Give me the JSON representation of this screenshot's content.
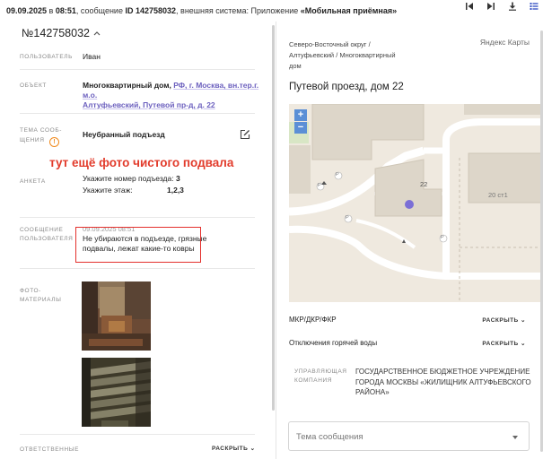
{
  "topbar": {
    "date": "09.09.2025",
    "in_label": " в ",
    "time": "08:51",
    "msg_label": ", сообщение ",
    "id_label": "ID 142758032",
    "system_label": ", внешняя система: Приложение ",
    "system_value": "«Мобильная приёмная»",
    "tools": [
      "first-page-icon",
      "last-page-icon",
      "download-icon",
      "list-icon"
    ]
  },
  "record": {
    "number": "№142758032",
    "user_label": "ПОЛЬЗОВАТЕЛЬ",
    "user_value": "Иван",
    "object_label": "ОБЪЕКТ",
    "object_type": "Многоквартирный дом, ",
    "object_link1": "РФ, г. Москва, вн.тер.г. м.о.",
    "object_link2": "Алтуфьевский, Путевой пр-д, д. 22",
    "topic_label_1": "ТЕМА СООБ-",
    "topic_label_2": "ЩЕНИЯ",
    "topic_value": "Неубранный подъезд",
    "survey_label": "АНКЕТА",
    "survey_q1": "Укажите номер подъезда:",
    "survey_a1": "3",
    "survey_q2": "Укажите этаж:",
    "survey_a2": "1,2,3",
    "message_label_1": "СООБЩЕНИЕ",
    "message_label_2": "ПОЛЬЗОВАТЕЛЯ",
    "message_date": "09.09.2025 08:51",
    "message_text": "Не убираются в подъезде, грязные подвалы, лежат какие-то ковры",
    "photos_label_1": "ФОТО-",
    "photos_label_2": "МАТЕРИАЛЫ",
    "responsible_label": "ОТВЕТСТВЕННЫЕ",
    "expand_label": "РАСКРЫТЬ"
  },
  "annotation": {
    "text": "тут ещё фото чистого подвала",
    "color": "#e23b2b"
  },
  "right": {
    "district": "Северо-Восточный округ /",
    "subdistrict": "Алтуфьевский / Многоквартирный",
    "subdistrict2": "дом",
    "map_provider": "Яндекс Карты",
    "address": "Путевой проезд, дом 22",
    "map": {
      "zoom_in": "+",
      "zoom_out": "−",
      "building_number": "22",
      "building_other": "20 ст1",
      "place_markers": [
        "P",
        "P",
        "P",
        "P"
      ]
    },
    "sections": [
      {
        "label": "МКР/ДКР/ФКР",
        "expand": "РАСКРЫТЬ"
      },
      {
        "label": "Отключения горячей воды",
        "expand": "РАСКРЫТЬ"
      }
    ],
    "org_label_1": "УПРАВЛЯЮЩАЯ",
    "org_label_2": "КОМПАНИЯ",
    "org_value": "Государственное бюджетное учреждение города Москвы «Жилищник Алтуфьевского района»",
    "topic_select_placeholder": "Тема сообщения"
  },
  "colors": {
    "accent_link": "#6b5fbe",
    "warning": "#f08a1c",
    "annotation_red": "#e23b2b",
    "map_pin": "#7b6fd6"
  }
}
